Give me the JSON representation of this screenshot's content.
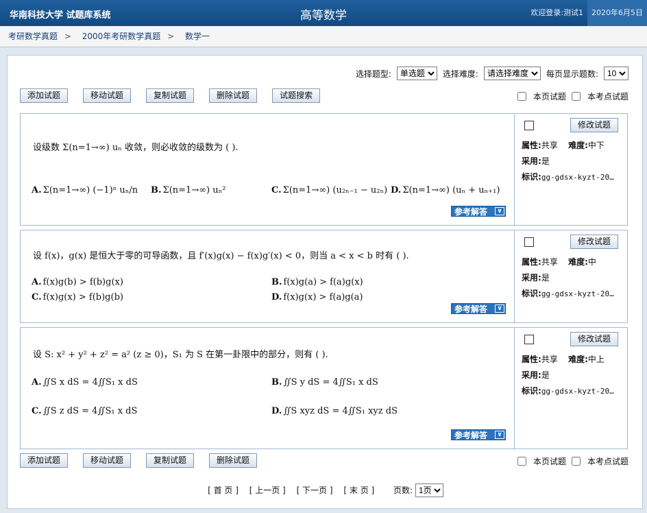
{
  "header": {
    "brand": "华南科技大学  试题库系统",
    "subject": "高等数学",
    "welcome": "欢迎登录:测试1",
    "date": "2020年6月5日"
  },
  "breadcrumb": [
    "考研数学真题",
    "2000年考研数学真题",
    "数学一"
  ],
  "filters": {
    "type_label": "选择题型:",
    "type_value": "单选题",
    "difficulty_label": "选择难度:",
    "difficulty_value": "请选择难度",
    "perpage_label": "每页显示题数:",
    "perpage_value": "10"
  },
  "toolbar_top": {
    "add": "添加试题",
    "move": "移动试题",
    "copy": "复制试题",
    "delete": "删除试题",
    "search": "试题搜索"
  },
  "toolbar_bottom": {
    "add": "添加试题",
    "move": "移动试题",
    "copy": "复制试题",
    "delete": "删除试题"
  },
  "checks": {
    "this_page": "本页试题",
    "this_point": "本考点试题"
  },
  "questions": [
    {
      "stem": "设级数 Σ(n=1→∞) uₙ 收敛，则必收敛的级数为 ( ).",
      "options": [
        {
          "label": "A.",
          "text": "Σ(n=1→∞) (−1)ⁿ uₙ/n"
        },
        {
          "label": "B.",
          "text": "Σ(n=1→∞) uₙ²"
        },
        {
          "label": "C.",
          "text": "Σ(n=1→∞) (u₂ₙ₋₁ − u₂ₙ)"
        },
        {
          "label": "D.",
          "text": "Σ(n=1→∞) (uₙ + uₙ₊₁)"
        }
      ],
      "ref": "参考解答",
      "edit": "修改试题",
      "attr_label": "属性:",
      "attr": "共享",
      "diff_label": "难度:",
      "diff": "中下",
      "use_label": "采用:",
      "use": "是",
      "tag_label": "标识:",
      "tag": "gg-gdsx-kyzt-20…"
    },
    {
      "stem": "设 f(x)，g(x) 是恒大于零的可导函数，且 f′(x)g(x) − f(x)g′(x) < 0，则当 a < x < b 时有 ( ).",
      "options": [
        {
          "label": "A.",
          "text": "f(x)g(b) > f(b)g(x)"
        },
        {
          "label": "B.",
          "text": "f(x)g(a) > f(a)g(x)"
        },
        {
          "label": "C.",
          "text": "f(x)g(x) > f(b)g(b)"
        },
        {
          "label": "D.",
          "text": "f(x)g(x) > f(a)g(a)"
        }
      ],
      "ref": "参考解答",
      "edit": "修改试题",
      "attr_label": "属性:",
      "attr": "共享",
      "diff_label": "难度:",
      "diff": "中",
      "use_label": "采用:",
      "use": "是",
      "tag_label": "标识:",
      "tag": "gg-gdsx-kyzt-20…"
    },
    {
      "stem": "设 S: x² + y² + z² = a² (z ≥ 0)，S₁ 为 S 在第一卦限中的部分，则有 ( ).",
      "options": [
        {
          "label": "A.",
          "text": "∬S x dS = 4∬S₁ x dS"
        },
        {
          "label": "B.",
          "text": "∬S y dS = 4∬S₁ x dS"
        },
        {
          "label": "C.",
          "text": "∬S z dS = 4∬S₁ x dS"
        },
        {
          "label": "D.",
          "text": "∬S xyz dS = 4∬S₁ xyz dS"
        }
      ],
      "ref": "参考解答",
      "edit": "修改试题",
      "attr_label": "属性:",
      "attr": "共享",
      "diff_label": "难度:",
      "diff": "中上",
      "use_label": "采用:",
      "use": "是",
      "tag_label": "标识:",
      "tag": "gg-gdsx-kyzt-20…"
    }
  ],
  "pager": {
    "first": "[ 首 页 ]",
    "prev": "[ 上一页 ]",
    "next": "[ 下一页 ]",
    "last": "[ 末 页 ]",
    "pages_label": "页数:",
    "page_value": "1页"
  }
}
